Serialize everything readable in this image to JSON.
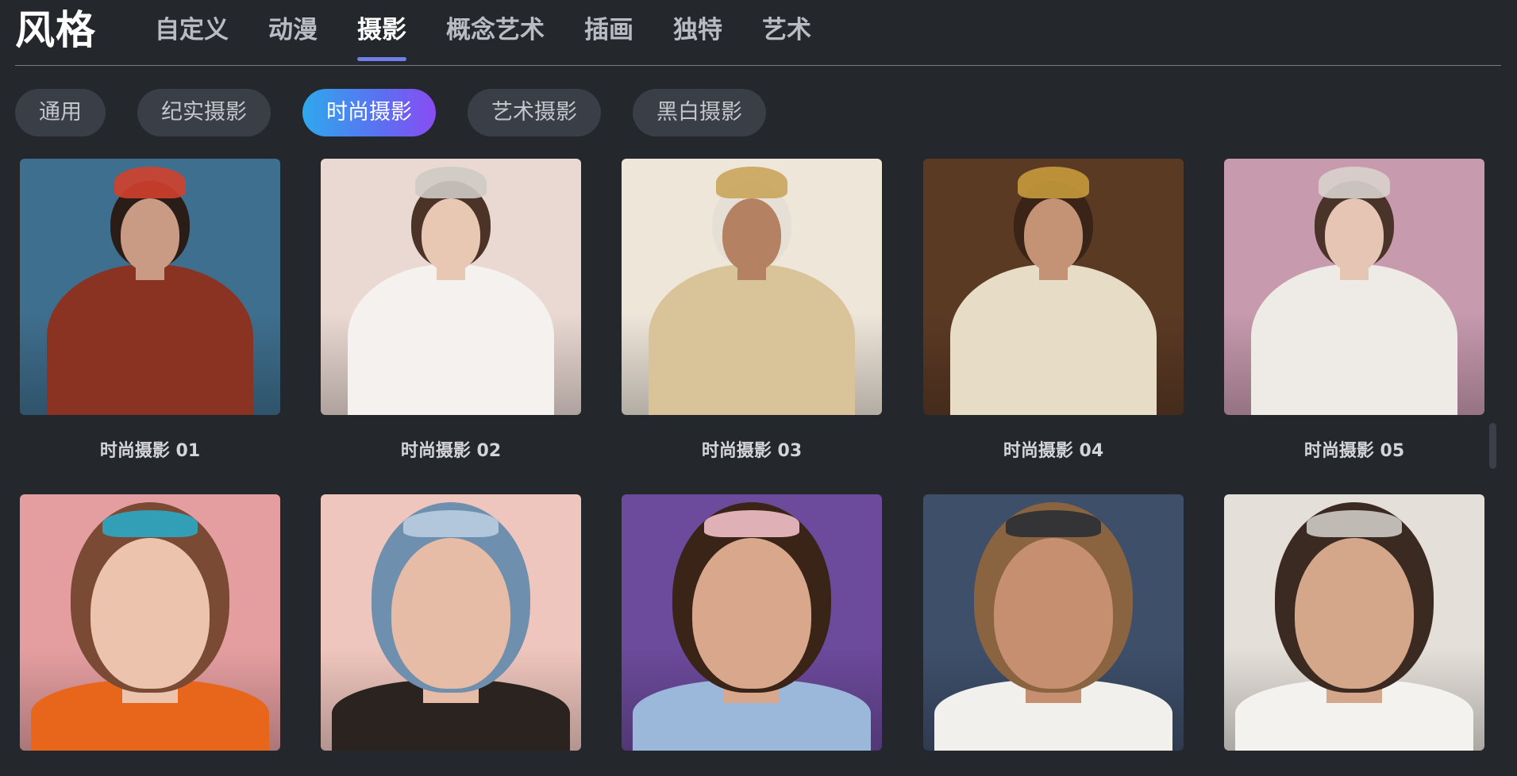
{
  "header": {
    "title": "风格",
    "tabs": [
      {
        "label": "自定义",
        "active": false
      },
      {
        "label": "动漫",
        "active": false
      },
      {
        "label": "摄影",
        "active": true
      },
      {
        "label": "概念艺术",
        "active": false
      },
      {
        "label": "插画",
        "active": false
      },
      {
        "label": "独特",
        "active": false
      },
      {
        "label": "艺术",
        "active": false
      }
    ]
  },
  "filters": [
    {
      "label": "通用",
      "active": false
    },
    {
      "label": "纪实摄影",
      "active": false
    },
    {
      "label": "时尚摄影",
      "active": true
    },
    {
      "label": "艺术摄影",
      "active": false
    },
    {
      "label": "黑白摄影",
      "active": false
    }
  ],
  "gallery": [
    {
      "caption": "时尚摄影 01",
      "bg": "#3f6f8e",
      "skin": "#c99a84",
      "outfit": "#8a3322",
      "hair": "#2a1d18",
      "accent": "#d2402c",
      "image_name": "fashion-photo-01-image"
    },
    {
      "caption": "时尚摄影 02",
      "bg": "#ead9d3",
      "skin": "#e8c7b3",
      "outfit": "#f4f1ee",
      "hair": "#4b3328",
      "accent": "#cfcac4",
      "image_name": "fashion-photo-02-image"
    },
    {
      "caption": "时尚摄影 03",
      "bg": "#efe6da",
      "skin": "#b48262",
      "outfit": "#d9c49a",
      "hair": "#e6dfd5",
      "accent": "#c9a45c",
      "image_name": "fashion-photo-03-image"
    },
    {
      "caption": "时尚摄影 04",
      "bg": "#5b3a24",
      "skin": "#c49275",
      "outfit": "#e7dcc6",
      "hair": "#3a2418",
      "accent": "#c79a3c",
      "image_name": "fashion-photo-04-image"
    },
    {
      "caption": "时尚摄影 05",
      "bg": "#c79aae",
      "skin": "#e6c5b5",
      "outfit": "#eeeae5",
      "hair": "#4a3328",
      "accent": "#d8d2cc",
      "image_name": "fashion-photo-05-image"
    },
    {
      "caption": "",
      "bg": "#e59ea0",
      "skin": "#ecc3ac",
      "outfit": "#e8661c",
      "hair": "#7a4a34",
      "accent": "#2aa9c4",
      "image_name": "fashion-photo-06-image"
    },
    {
      "caption": "",
      "bg": "#efc6be",
      "skin": "#e6bca6",
      "outfit": "#2a2320",
      "hair": "#6e8fae",
      "accent": "#b9cde0",
      "image_name": "fashion-photo-07-image"
    },
    {
      "caption": "",
      "bg": "#6c4a9c",
      "skin": "#d9a88c",
      "outfit": "#9bb7d9",
      "hair": "#3a2418",
      "accent": "#f2c0c8",
      "image_name": "fashion-photo-08-image"
    },
    {
      "caption": "",
      "bg": "#3e4f6a",
      "skin": "#c58f70",
      "outfit": "#f2f0ec",
      "hair": "#8a6440",
      "accent": "#2a2d35",
      "image_name": "fashion-photo-09-image"
    },
    {
      "caption": "",
      "bg": "#e4dfd9",
      "skin": "#d4a68a",
      "outfit": "#f4f2ef",
      "hair": "#3a2a22",
      "accent": "#cfcac4",
      "image_name": "fashion-photo-10-image"
    }
  ]
}
